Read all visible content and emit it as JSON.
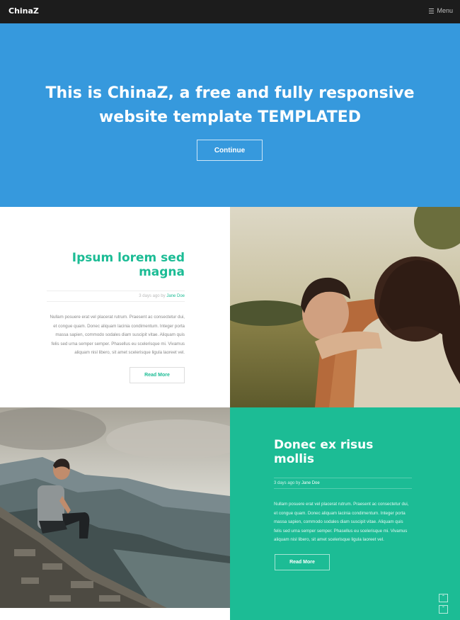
{
  "topbar": {
    "logo": "ChinaZ",
    "menu_label": "Menu"
  },
  "hero": {
    "title_line1": "This is ChinaZ, a free and fully responsive",
    "title_line2": "website template TEMPLATED",
    "button_label": "Continue"
  },
  "posts": [
    {
      "title": "Ipsum lorem sed magna",
      "meta_prefix": "3 days ago by ",
      "author": "Jane Doe",
      "excerpt": "Nullam posuere erat vel placerat rutrum. Praesent ac consectetur dui, et congue quam. Donec aliquam lacinia condimentum. Integer porta massa sapien, commodo sodales diam suscipit vitae. Aliquam quis felis sed urna semper semper. Phasellus eu scelerisque mi. Vivamus aliquam nisl libero, sit amet scelerisque ligula laoreet vel.",
      "button_label": "Read More"
    },
    {
      "title": "Donec ex risus mollis",
      "meta_prefix": "3 days ago by ",
      "author": "Jane Doe",
      "excerpt": "Nullam posuere erat vel placerat rutrum. Praesent ac consectetur dui, et congue quam. Donec aliquam lacinia condimentum. Integer porta massa sapien, commodo sodales diam suscipit vitae. Aliquam quis felis sed urna semper semper. Phasellus eu scelerisque mi. Vivamus aliquam nisl libero, sit amet scelerisque ligula laoreet vel.",
      "button_label": "Read More"
    }
  ],
  "colors": {
    "accent": "#1cbc95",
    "hero_bg": "#3699dd",
    "topbar_bg": "#1c1c1c"
  },
  "scroll_controls": {
    "up_icon": "chevron-up-icon",
    "down_icon": "chevron-down-icon"
  }
}
